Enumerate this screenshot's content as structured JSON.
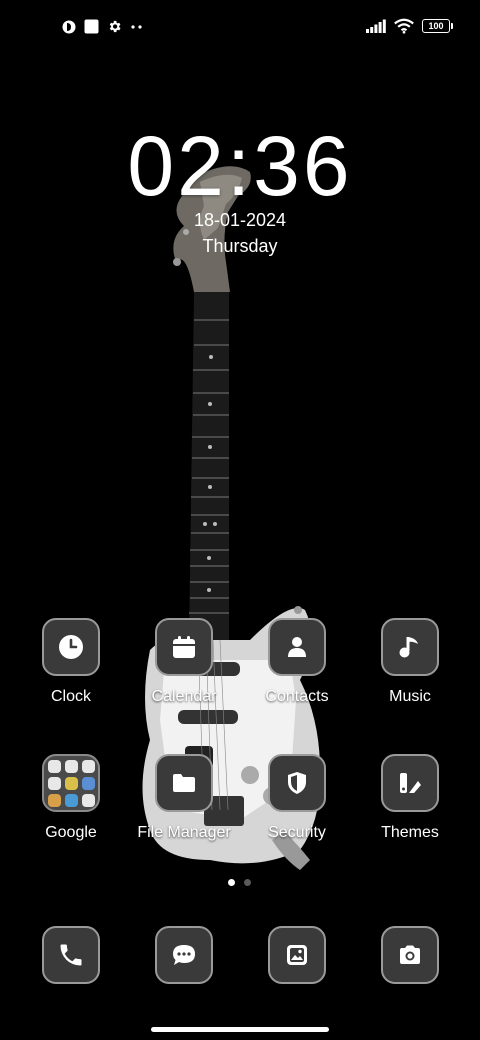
{
  "status_bar": {
    "left_icons": [
      "app-notification-icon",
      "square-notification-icon",
      "settings-gear-icon",
      "more-dots-icon"
    ],
    "right_icons": [
      "signal-icon",
      "wifi-icon",
      "battery-icon"
    ],
    "battery": "100"
  },
  "lockscreen": {
    "time": "02:36",
    "date": "18-01-2024",
    "day": "Thursday"
  },
  "home_apps": [
    {
      "label": "Clock",
      "icon": "clock-icon"
    },
    {
      "label": "Calendar",
      "icon": "calendar-icon"
    },
    {
      "label": "Contacts",
      "icon": "contacts-icon"
    },
    {
      "label": "Music",
      "icon": "music-note-icon"
    },
    {
      "label": "Google",
      "icon": "google-folder-icon"
    },
    {
      "label": "File Manager",
      "icon": "folder-icon"
    },
    {
      "label": "Security",
      "icon": "shield-icon"
    },
    {
      "label": "Themes",
      "icon": "themes-icon"
    }
  ],
  "page_indicator": {
    "current": 1,
    "total": 2
  },
  "dock": [
    {
      "icon": "phone-icon"
    },
    {
      "icon": "messages-icon"
    },
    {
      "icon": "gallery-icon"
    },
    {
      "icon": "camera-icon"
    }
  ],
  "colors": {
    "background": "#000000",
    "tile": "#3a3a3a",
    "tile_border": "#9a9a9a",
    "text": "#ffffff"
  }
}
